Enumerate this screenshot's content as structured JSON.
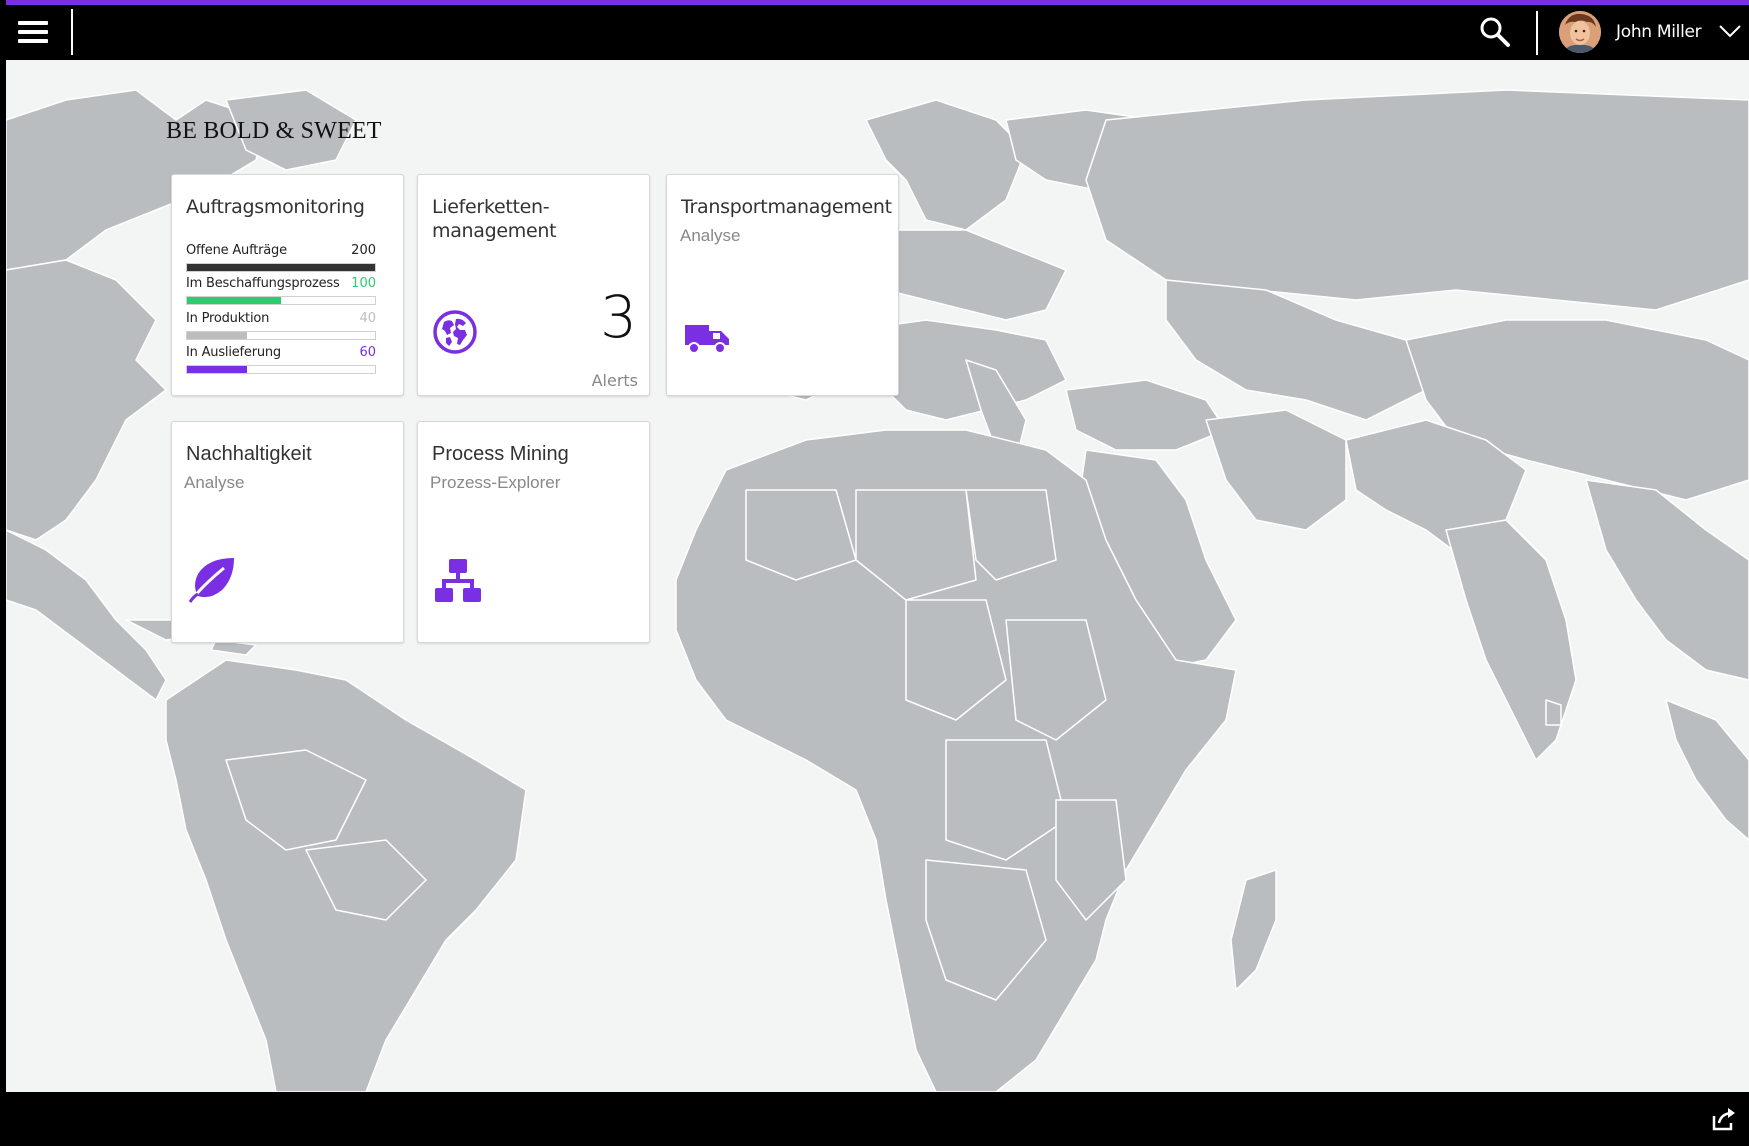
{
  "colors": {
    "accent": "#7b2fe2",
    "green": "#2ecc71",
    "dark": "#333333",
    "grey": "#bdbdbd",
    "land": "#b9bdbf",
    "ocean": "#f3f4f4"
  },
  "shell": {
    "menu_icon": "hamburger-menu-icon",
    "search_icon": "search-icon",
    "user_name": "John Miller",
    "user_menu_icon": "chevron-down-icon"
  },
  "group": {
    "title": "BE BOLD & SWEET"
  },
  "tiles": {
    "auftrag": {
      "title": "Auftragsmonitoring",
      "bars": [
        {
          "label": "Offene Aufträge",
          "value": "200",
          "fraction": 1.0,
          "color": "#333333",
          "value_color": "#222222"
        },
        {
          "label": "Im Beschaffungsprozess",
          "value": "100",
          "fraction": 0.5,
          "color": "#2ecc71",
          "value_color": "#2ecc71"
        },
        {
          "label": "In Produktion",
          "value": "40",
          "fraction": 0.32,
          "color": "#bdbdbd",
          "value_color": "#bdbdbd"
        },
        {
          "label": "In Auslieferung",
          "value": "60",
          "fraction": 0.32,
          "color": "#7b2fe2",
          "value_color": "#7b2fe2"
        }
      ]
    },
    "liefer": {
      "title_line1": "Lieferketten-",
      "title_line2": "management",
      "icon": "globe-icon",
      "number": "3",
      "unit": "Alerts"
    },
    "transport": {
      "title": "Transportmanagement",
      "subtitle": "Analyse",
      "icon": "truck-icon"
    },
    "nachhalt": {
      "title": "Nachhaltigkeit",
      "subtitle": "Analyse",
      "icon": "leaf-icon"
    },
    "process": {
      "title": "Process Mining",
      "subtitle": "Prozess-Explorer",
      "icon": "hierarchy-icon"
    }
  },
  "footer": {
    "share_icon": "share-icon"
  }
}
